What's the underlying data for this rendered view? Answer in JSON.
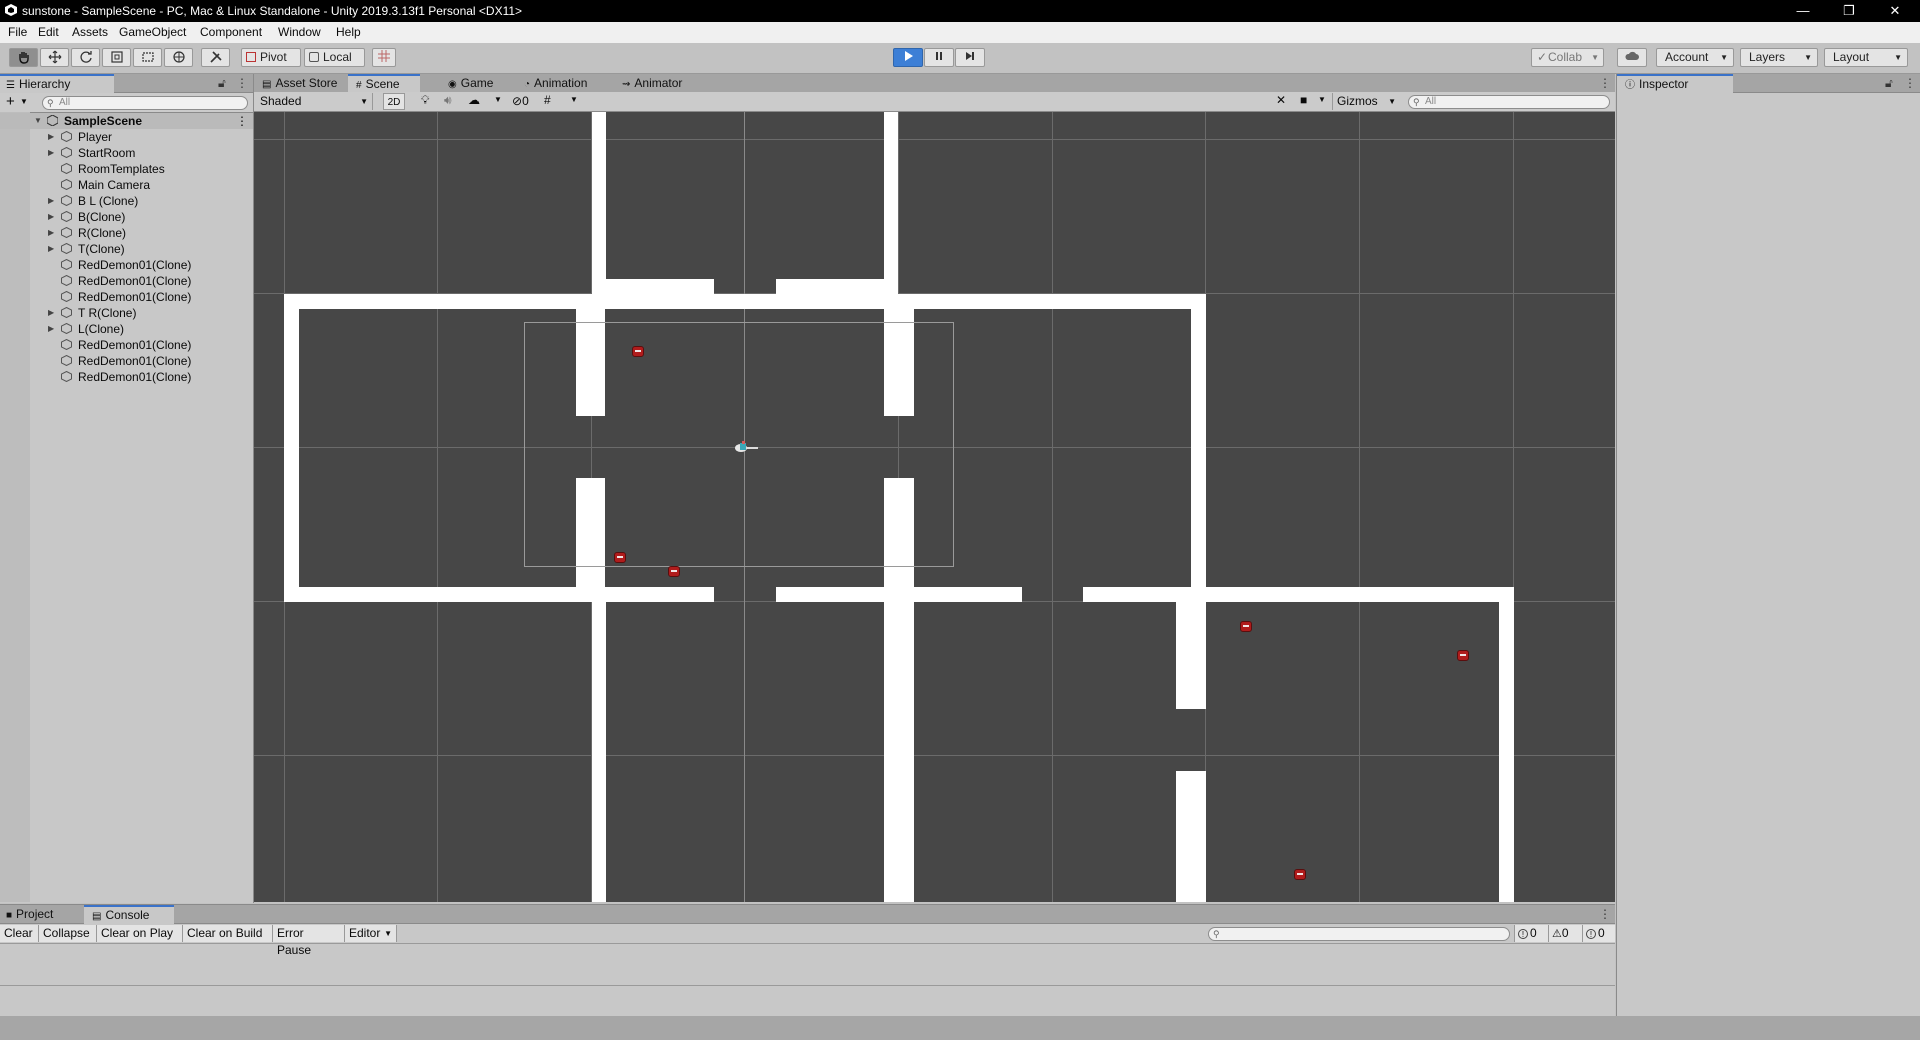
{
  "window": {
    "title": "sunstone - SampleScene - PC, Mac & Linux Standalone - Unity 2019.3.13f1 Personal <DX11>",
    "minimize": "—",
    "maximize": "❐",
    "close": "✕"
  },
  "menu": [
    "File",
    "Edit",
    "Assets",
    "GameObject",
    "Component",
    "Window",
    "Help"
  ],
  "toolbar": {
    "pivot": "Pivot",
    "local": "Local",
    "collab": "Collab",
    "account": "Account",
    "layers": "Layers",
    "layout": "Layout"
  },
  "hierarchy": {
    "tab": "Hierarchy",
    "search_placeholder": "All",
    "scene": "SampleScene",
    "items": [
      {
        "label": "Player",
        "expandable": true
      },
      {
        "label": "StartRoom",
        "expandable": true
      },
      {
        "label": "RoomTemplates",
        "expandable": false
      },
      {
        "label": "Main Camera",
        "expandable": false
      },
      {
        "label": "B L (Clone)",
        "expandable": true
      },
      {
        "label": "B(Clone)",
        "expandable": true
      },
      {
        "label": "R(Clone)",
        "expandable": true
      },
      {
        "label": "T(Clone)",
        "expandable": true
      },
      {
        "label": "RedDemon01(Clone)",
        "expandable": false
      },
      {
        "label": "RedDemon01(Clone)",
        "expandable": false
      },
      {
        "label": "RedDemon01(Clone)",
        "expandable": false
      },
      {
        "label": "T R(Clone)",
        "expandable": true
      },
      {
        "label": "L(Clone)",
        "expandable": true
      },
      {
        "label": "RedDemon01(Clone)",
        "expandable": false
      },
      {
        "label": "RedDemon01(Clone)",
        "expandable": false
      },
      {
        "label": "RedDemon01(Clone)",
        "expandable": false
      }
    ]
  },
  "scene_tabs": [
    "Asset Store",
    "Scene",
    "Game",
    "Animation",
    "Animator"
  ],
  "scene_toolbar": {
    "draw_mode": "Shaded",
    "mode_2d": "2D",
    "hidden_count": "0",
    "gizmos": "Gizmos",
    "search_placeholder": "All"
  },
  "inspector": {
    "tab": "Inspector"
  },
  "console": {
    "tabs": [
      "Project",
      "Console"
    ],
    "buttons": [
      "Clear",
      "Collapse",
      "Clear on Play",
      "Clear on Build",
      "Error Pause",
      "Editor"
    ],
    "log_count": "0",
    "warning_count": "0",
    "error_count": "0"
  },
  "colors": {
    "accent": "#3a72c9",
    "scene_bg": "#474747",
    "wall": "#ffffff",
    "enemy": "#b01c1c"
  }
}
